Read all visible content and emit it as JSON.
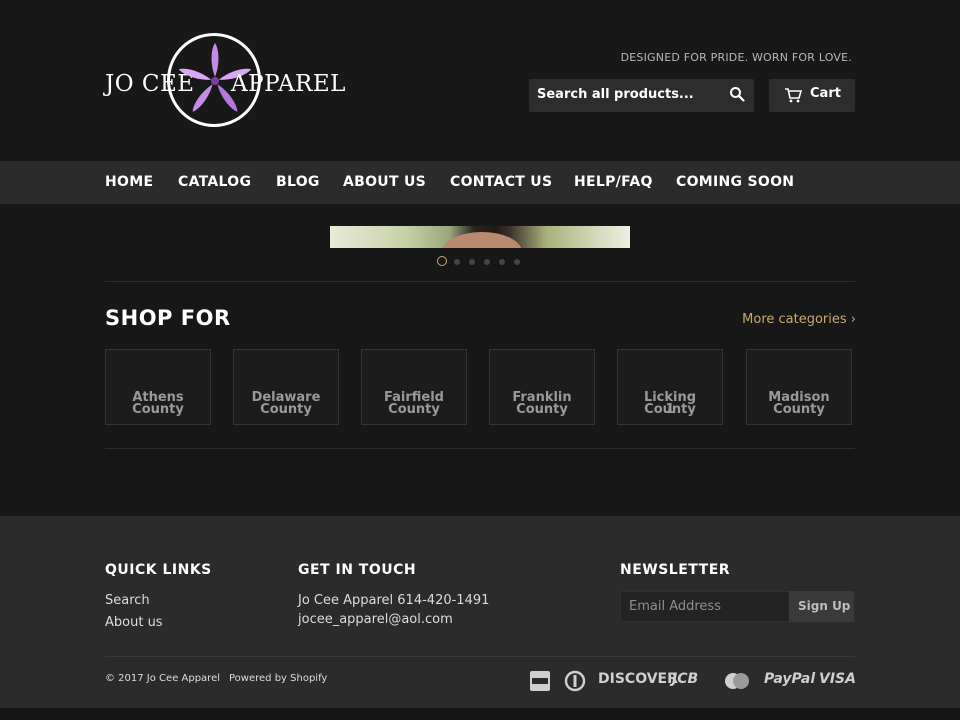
{
  "header": {
    "brand_left": "JO CEE",
    "brand_right": "APPAREL",
    "tagline": "DESIGNED FOR PRIDE. WORN FOR LOVE.",
    "search_placeholder": "Search all products...",
    "cart_label": "Cart"
  },
  "nav": {
    "items": [
      "HOME",
      "CATALOG",
      "BLOG",
      "ABOUT US",
      "CONTACT US",
      "HELP/FAQ",
      "COMING SOON"
    ]
  },
  "slider": {
    "slide_count": 6,
    "active_index": 0
  },
  "shop": {
    "title": "SHOP FOR",
    "more_link": "More categories ›",
    "categories": [
      {
        "line1": "Athens County",
        "line2": ""
      },
      {
        "line1": "Delaware",
        "line2": "County"
      },
      {
        "line1": "Fairfield County",
        "line2": ""
      },
      {
        "line1": "Franklin County",
        "line2": ""
      },
      {
        "line1": "Licking County",
        "line2": "1"
      },
      {
        "line1": "Madison",
        "line2": "County"
      }
    ]
  },
  "footer": {
    "quick_links_title": "QUICK LINKS",
    "quick_links": [
      "Search",
      "About us"
    ],
    "contact_title": "GET IN TOUCH",
    "contact_phone": "Jo Cee Apparel 614-420-1491",
    "contact_email": "jocee_apparel@aol.com",
    "newsletter_title": "NEWSLETTER",
    "email_placeholder": "Email Address",
    "signup_label": "Sign Up",
    "copyright": "© 2017 Jo Cee Apparel",
    "powered_by": "Powered by Shopify",
    "payments": [
      "american-express-icon",
      "diners-club-icon",
      "DISCOVER",
      "JCB",
      "master-icon",
      "PayPal",
      "VISA"
    ]
  },
  "colors": {
    "accent": "#c9a96e",
    "lily": "#c58be6",
    "background": "#171717",
    "panel": "#2b2b2b"
  }
}
